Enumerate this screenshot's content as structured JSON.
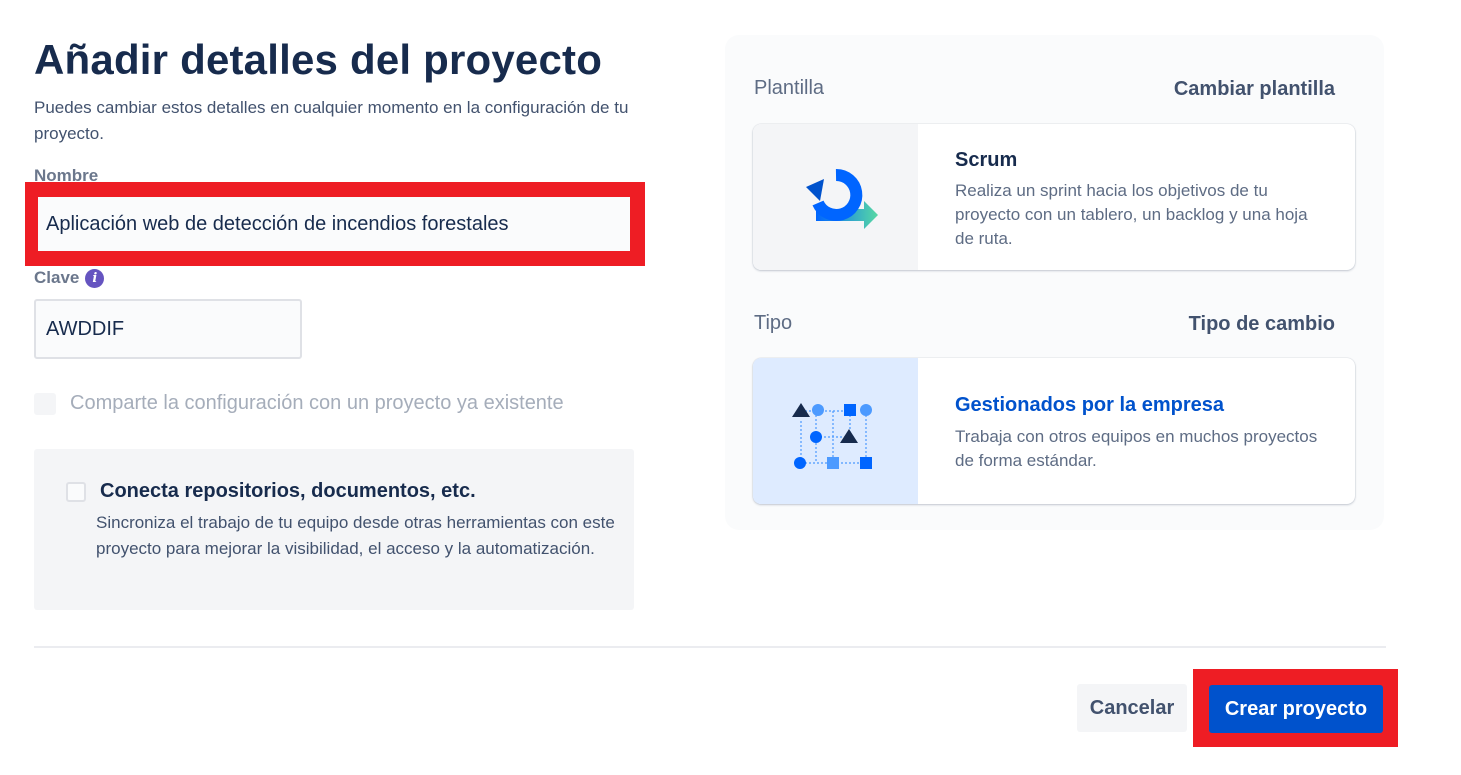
{
  "header": {
    "title": "Añadir detalles del proyecto",
    "subtitle": "Puedes cambiar estos detalles en cualquier momento en la configuración de tu proyecto."
  },
  "form": {
    "name_label": "Nombre",
    "name_value": "Aplicación web de detección de incendios forestales",
    "key_label": "Clave",
    "key_value": "AWDDIF",
    "share_label": "Comparte la configuración con un proyecto ya existente"
  },
  "connect": {
    "title": "Conecta repositorios, documentos, etc.",
    "description": "Sincroniza el trabajo de tu equipo desde otras herramientas con este proyecto para mejorar la visibilidad, el acceso y la automatización."
  },
  "template": {
    "section_label": "Plantilla",
    "change_link": "Cambiar plantilla",
    "name": "Scrum",
    "description": "Realiza un sprint hacia los objetivos de tu proyecto con un tablero, un backlog y una hoja de ruta."
  },
  "type": {
    "section_label": "Tipo",
    "change_link": "Tipo de cambio",
    "name": "Gestionados por la empresa",
    "description": "Trabaja con otros equipos en muchos proyectos de forma estándar."
  },
  "footer": {
    "cancel_label": "Cancelar",
    "create_label": "Crear proyecto"
  },
  "colors": {
    "primary": "#0052cc",
    "text": "#172b4d",
    "highlight": "#ee1d24",
    "info": "#6554c0"
  },
  "icons": {
    "info": "info-icon",
    "template": "scrum-cycle-icon",
    "type": "company-managed-icon"
  }
}
